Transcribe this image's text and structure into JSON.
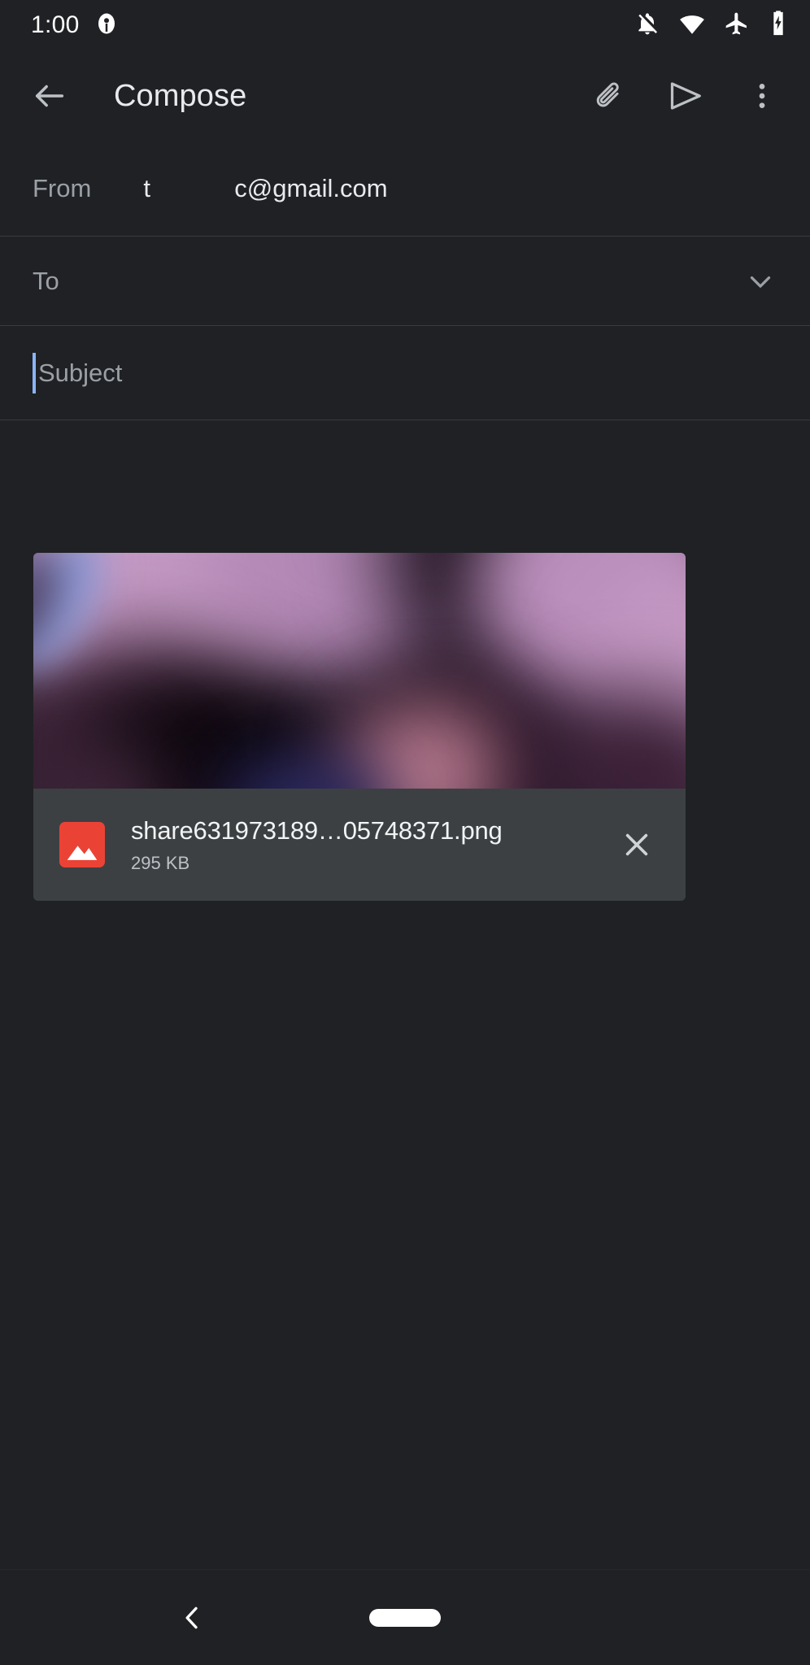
{
  "status_bar": {
    "time": "1:00",
    "left_icons": [
      {
        "name": "app-notification-icon",
        "label": "app notification"
      }
    ],
    "right_icons": [
      {
        "name": "notifications-off-icon",
        "label": "notifications silenced"
      },
      {
        "name": "wifi-icon",
        "label": "wifi connected"
      },
      {
        "name": "airplane-mode-icon",
        "label": "airplane mode on"
      },
      {
        "name": "battery-charging-icon",
        "label": "battery charging"
      }
    ]
  },
  "app_bar": {
    "back_label": "Navigate up",
    "title": "Compose",
    "attach_label": "Attach file",
    "send_label": "Send",
    "more_label": "More options"
  },
  "fields": {
    "from": {
      "label": "From",
      "address": "t            c@gmail.com"
    },
    "to": {
      "placeholder": "To",
      "value": "",
      "expand_label": "Expand recipients"
    },
    "subject": {
      "placeholder": "Subject",
      "value": "",
      "focused": true
    },
    "body": {
      "placeholder": "",
      "value": ""
    }
  },
  "attachment": {
    "file_name": "share631973189…05748371.png",
    "file_size": "295 KB",
    "file_type": "png",
    "type_icon": "image-icon",
    "remove_label": "Remove attachment",
    "accent_color": "#ea4335"
  },
  "nav_bar": {
    "back_label": "Back",
    "home_label": "Home"
  },
  "colors": {
    "background": "#202124",
    "surface": "#3c4043",
    "divider": "#3a3b3d",
    "text_primary": "#e8eaed",
    "text_secondary": "#9aa0a6",
    "caret": "#8ab4f8",
    "attachment_accent": "#ea4335"
  }
}
